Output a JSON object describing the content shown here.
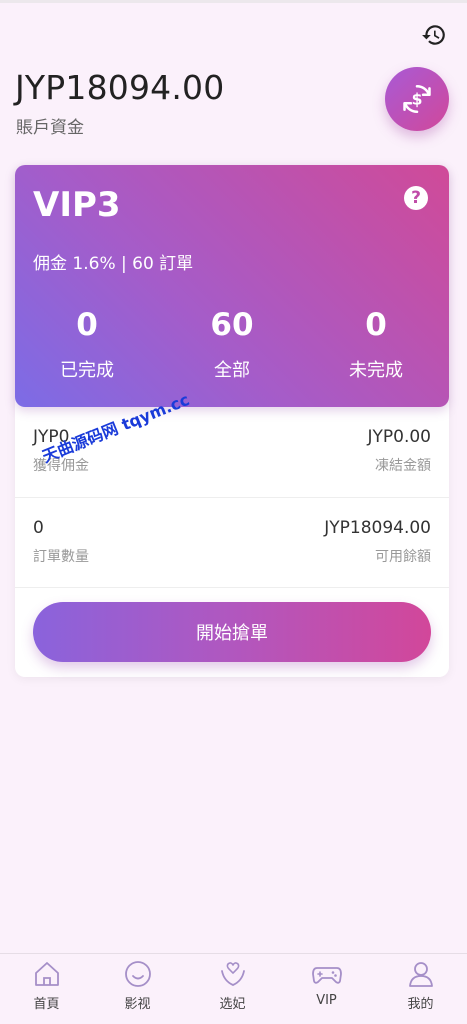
{
  "header": {
    "balance": "JYP18094.00",
    "balance_label": "賬戶資金"
  },
  "vip": {
    "level": "VIP3",
    "help_symbol": "?",
    "commission": "佣金 1.6% | 60 訂單",
    "stats": [
      {
        "value": "0",
        "label": "已完成"
      },
      {
        "value": "60",
        "label": "全部"
      },
      {
        "value": "0",
        "label": "未完成"
      }
    ]
  },
  "details": {
    "earned_value": "JYP0",
    "earned_label": "獲得佣金",
    "frozen_value": "JYP0.00",
    "frozen_label": "凍結金額",
    "orders_value": "0",
    "orders_label": "訂單數量",
    "available_value": "JYP18094.00",
    "available_label": "可用餘額"
  },
  "action": {
    "start_label": "開始搶單"
  },
  "watermark": "天曲源码网 tqym.cc",
  "tabs": [
    {
      "label": "首頁",
      "icon": "home-icon"
    },
    {
      "label": "影视",
      "icon": "smile-icon"
    },
    {
      "label": "选妃",
      "icon": "heart-hands-icon"
    },
    {
      "label": "VIP",
      "icon": "gamepad-icon"
    },
    {
      "label": "我的",
      "icon": "user-icon"
    }
  ],
  "colors": {
    "accent_start": "#7c6ce6",
    "accent_end": "#d04a98",
    "background": "#fbf1fb"
  }
}
